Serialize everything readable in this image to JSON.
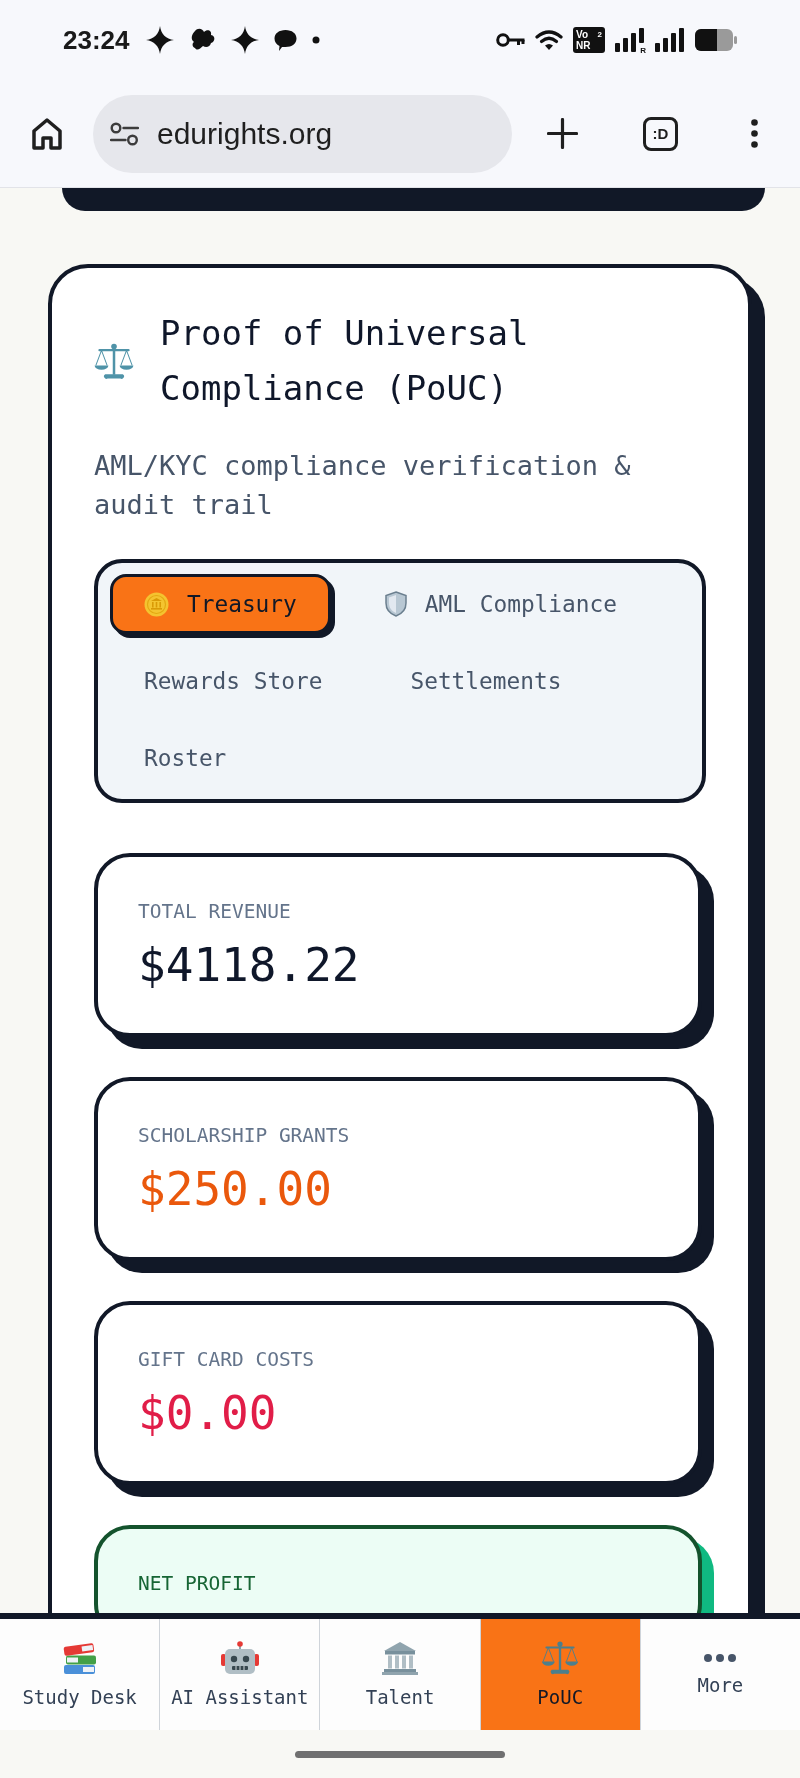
{
  "status_bar": {
    "time": "23:24",
    "network_badge": {
      "top": "Vo",
      "sim": "2",
      "bottom": "NR"
    },
    "roaming_mark": "R"
  },
  "browser": {
    "url": "edurights.org",
    "tab_switcher": ":D"
  },
  "card": {
    "title": "Proof of Universal Compliance (PoUC)",
    "subtitle": "AML/KYC compliance verification & audit trail",
    "tabs": [
      {
        "label": "Treasury",
        "selected": true
      },
      {
        "label": "AML Compliance",
        "selected": false
      },
      {
        "label": "Rewards Store",
        "selected": false
      },
      {
        "label": "Settlements",
        "selected": false
      },
      {
        "label": "Roster",
        "selected": false
      }
    ],
    "stats": [
      {
        "kind": "plain",
        "label": "TOTAL REVENUE",
        "value": "$4118.22",
        "color": "#0f172a"
      },
      {
        "kind": "plain",
        "label": "SCHOLARSHIP GRANTS",
        "value": "$250.00",
        "color": "#ea580c"
      },
      {
        "kind": "plain",
        "label": "GIFT CARD COSTS",
        "value": "$0.00",
        "color": "#e11d48"
      },
      {
        "kind": "highlight",
        "label": "NET PROFIT",
        "color": "#166534"
      }
    ]
  },
  "bottom_nav": [
    {
      "label": "Study Desk",
      "selected": false
    },
    {
      "label": "AI Assistant",
      "selected": false
    },
    {
      "label": "Talent",
      "selected": false
    },
    {
      "label": "PoUC",
      "selected": true
    },
    {
      "label": "More",
      "selected": false
    }
  ]
}
